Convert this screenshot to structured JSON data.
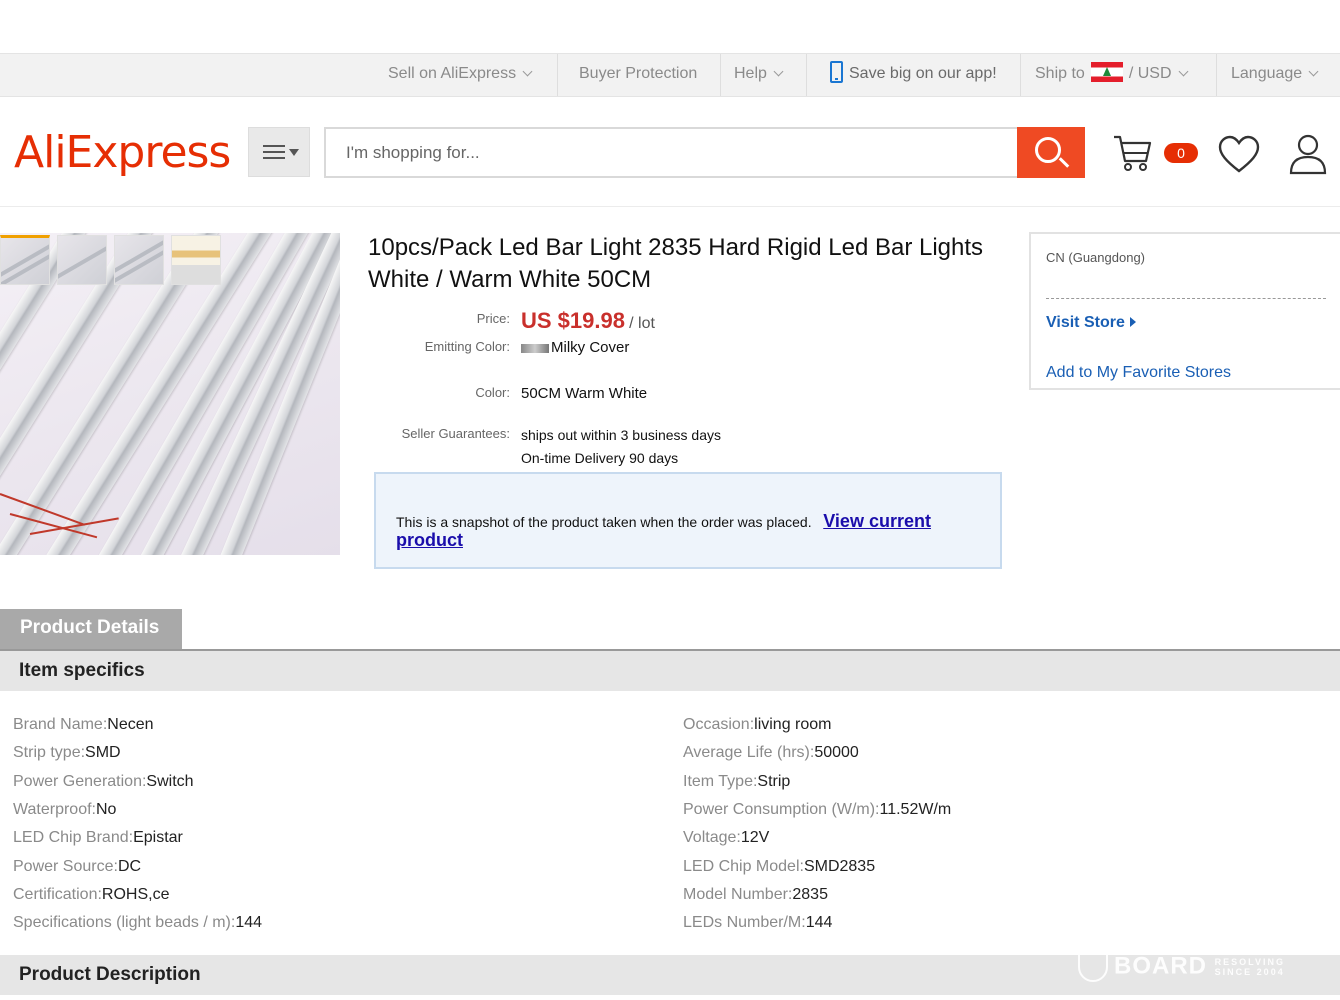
{
  "topbar": {
    "sell": "Sell on AliExpress",
    "buyer_protection": "Buyer Protection",
    "help": "Help",
    "app": "Save big on our app!",
    "ship_to": "Ship to",
    "currency_sep": "/",
    "currency": "USD",
    "language": "Language"
  },
  "header": {
    "logo": "AliExpress",
    "search_placeholder": "I'm shopping for...",
    "cart_count": "0"
  },
  "product": {
    "title": "10pcs/Pack Led Bar Light 2835 Hard Rigid Led Bar Lights White / Warm White 50CM",
    "price_label": "Price:",
    "price": "US $19.98",
    "price_unit": "/ lot",
    "emitting_label": "Emitting Color:",
    "emitting_value": "Milky Cover",
    "color_label": "Color:",
    "color_value": "50CM Warm White",
    "guarantee_label": "Seller Guarantees:",
    "guarantee_1": "ships out within 3 business days",
    "guarantee_2": "On-time Delivery 90 days"
  },
  "snapshot": {
    "text": "This is a snapshot of the product taken when the order was placed.",
    "link": "View current product"
  },
  "store": {
    "location": "CN (Guangdong)",
    "visit": "Visit Store",
    "favorite": "Add to My Favorite Stores"
  },
  "details": {
    "tab": "Product Details",
    "specifics_title": "Item specifics",
    "description_title": "Product Description",
    "left": [
      {
        "k": "Brand Name:",
        "v": "Necen"
      },
      {
        "k": "Strip type:",
        "v": "SMD"
      },
      {
        "k": "Power Generation:",
        "v": "Switch"
      },
      {
        "k": "Waterproof:",
        "v": "No"
      },
      {
        "k": "LED Chip Brand:",
        "v": "Epistar"
      },
      {
        "k": "Power Source:",
        "v": "DC"
      },
      {
        "k": "Certification:",
        "v": "ROHS,ce"
      },
      {
        "k": "Specifications (light beads / m):",
        "v": "144"
      }
    ],
    "right": [
      {
        "k": "Occasion:",
        "v": "living room"
      },
      {
        "k": "Average Life (hrs):",
        "v": "50000"
      },
      {
        "k": "Item Type:",
        "v": "Strip"
      },
      {
        "k": "Power Consumption (W/m):",
        "v": "11.52W/m"
      },
      {
        "k": "Voltage:",
        "v": "12V"
      },
      {
        "k": "LED Chip Model:",
        "v": "SMD2835"
      },
      {
        "k": "Model Number:",
        "v": "2835"
      },
      {
        "k": "LEDs Number/M:",
        "v": "144"
      }
    ]
  },
  "watermark": {
    "brand": "BOARD",
    "tag_1": "RESOLVING",
    "tag_2": "SINCE 2004"
  }
}
